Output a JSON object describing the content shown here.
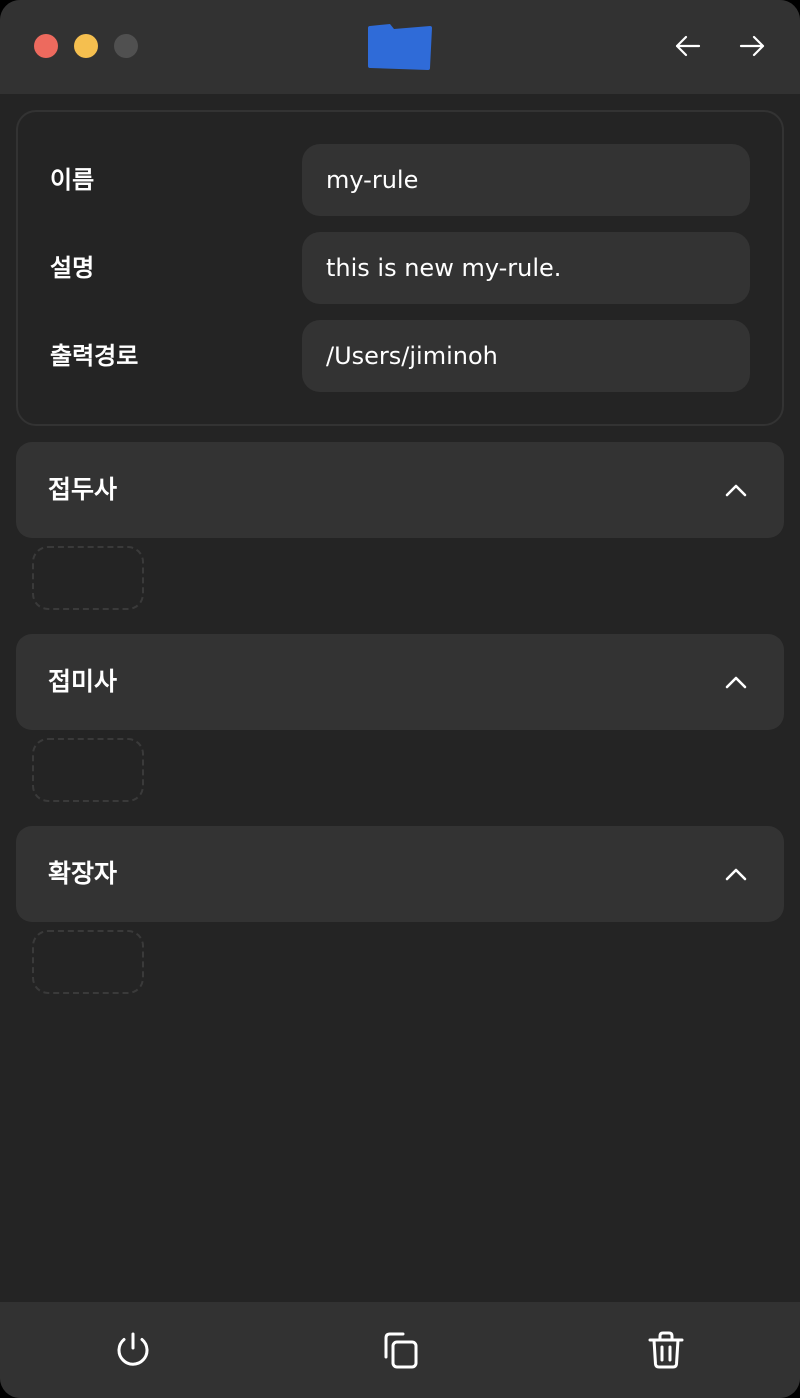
{
  "window": {
    "accent_color": "#2F6BD8",
    "traffic_lights": [
      "#ED6A5E",
      "#F5BF4F",
      "#505050"
    ]
  },
  "toolbar": {
    "app_icon": "folder-icon",
    "back_icon": "arrow-left-icon",
    "forward_icon": "arrow-right-icon"
  },
  "form": {
    "name_label": "이름",
    "name_value": "my-rule",
    "description_label": "설명",
    "description_value": "this is new my-rule.",
    "output_label": "출력경로",
    "output_value": "/Users/jiminoh"
  },
  "sections": [
    {
      "title": "접두사",
      "icon": "chevron-up-icon"
    },
    {
      "title": "접미사",
      "icon": "chevron-up-icon"
    },
    {
      "title": "확장자",
      "icon": "chevron-up-icon"
    }
  ],
  "bottom_bar": {
    "power_icon": "power-icon",
    "copy_icon": "copy-icon",
    "trash_icon": "trash-icon"
  }
}
